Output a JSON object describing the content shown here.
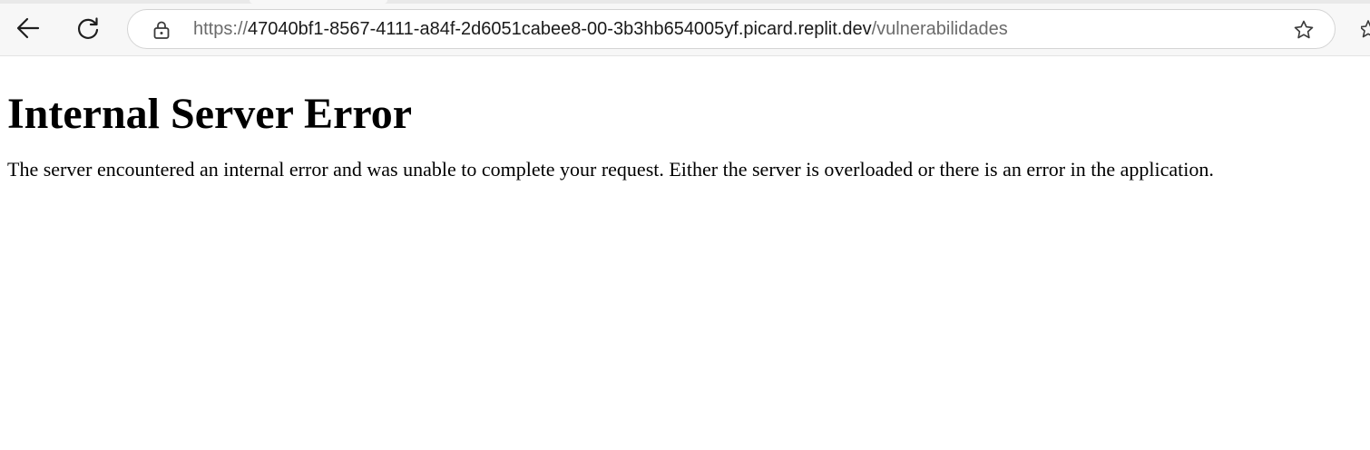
{
  "browser": {
    "url_scheme": "https://",
    "url_host": "47040bf1-8567-4111-a84f-2d6051cabee8-00-3b3hb654005yf.picard.replit.dev",
    "url_path": "/vulnerabilidades",
    "icons": {
      "back": "back-arrow-icon",
      "reload": "reload-icon",
      "lock": "lock-icon",
      "favorite": "star-icon"
    }
  },
  "page": {
    "heading": "Internal Server Error",
    "message": "The server encountered an internal error and was unable to complete your request. Either the server is overloaded or there is an error in the application."
  },
  "colors": {
    "chrome_background": "#f7f7f7",
    "address_border": "#d4d4d4",
    "url_dim": "#6b6b6b",
    "text": "#000000"
  }
}
